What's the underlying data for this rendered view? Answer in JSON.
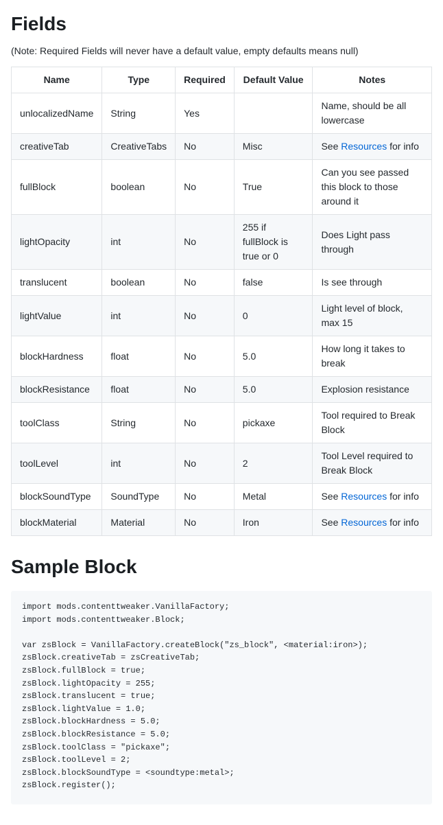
{
  "headings": {
    "fields": "Fields",
    "sample": "Sample Block"
  },
  "note": "(Note: Required Fields will never have a default value, empty defaults means null)",
  "table": {
    "headers": [
      "Name",
      "Type",
      "Required",
      "Default Value",
      "Notes"
    ],
    "link_text": "Resources",
    "see_prefix": "See ",
    "see_suffix": " for info",
    "rows": [
      {
        "name": "unlocalizedName",
        "type": "String",
        "required": "Yes",
        "default": "",
        "notes": "Name, should be all lowercase",
        "link": false
      },
      {
        "name": "creativeTab",
        "type": "CreativeTabs",
        "required": "No",
        "default": "Misc",
        "notes": "",
        "link": true
      },
      {
        "name": "fullBlock",
        "type": "boolean",
        "required": "No",
        "default": "True",
        "notes": "Can you see passed this block to those around it",
        "link": false
      },
      {
        "name": "lightOpacity",
        "type": "int",
        "required": "No",
        "default": "255 if fullBlock is true or 0",
        "notes": "Does Light pass through",
        "link": false
      },
      {
        "name": "translucent",
        "type": "boolean",
        "required": "No",
        "default": "false",
        "notes": "Is see through",
        "link": false
      },
      {
        "name": "lightValue",
        "type": "int",
        "required": "No",
        "default": "0",
        "notes": "Light level of block, max 15",
        "link": false
      },
      {
        "name": "blockHardness",
        "type": "float",
        "required": "No",
        "default": "5.0",
        "notes": "How long it takes to break",
        "link": false
      },
      {
        "name": "blockResistance",
        "type": "float",
        "required": "No",
        "default": "5.0",
        "notes": "Explosion resistance",
        "link": false
      },
      {
        "name": "toolClass",
        "type": "String",
        "required": "No",
        "default": "pickaxe",
        "notes": "Tool required to Break Block",
        "link": false
      },
      {
        "name": "toolLevel",
        "type": "int",
        "required": "No",
        "default": "2",
        "notes": "Tool Level required to Break Block",
        "link": false
      },
      {
        "name": "blockSoundType",
        "type": "SoundType",
        "required": "No",
        "default": "Metal",
        "notes": "",
        "link": true
      },
      {
        "name": "blockMaterial",
        "type": "Material",
        "required": "No",
        "default": "Iron",
        "notes": "",
        "link": true
      }
    ]
  },
  "code": "import mods.contenttweaker.VanillaFactory;\nimport mods.contenttweaker.Block;\n\nvar zsBlock = VanillaFactory.createBlock(\"zs_block\", <material:iron>);\nzsBlock.creativeTab = zsCreativeTab;\nzsBlock.fullBlock = true;\nzsBlock.lightOpacity = 255;\nzsBlock.translucent = true;\nzsBlock.lightValue = 1.0;\nzsBlock.blockHardness = 5.0;\nzsBlock.blockResistance = 5.0;\nzsBlock.toolClass = \"pickaxe\";\nzsBlock.toolLevel = 2;\nzsBlock.blockSoundType = <soundtype:metal>;\nzsBlock.register();"
}
